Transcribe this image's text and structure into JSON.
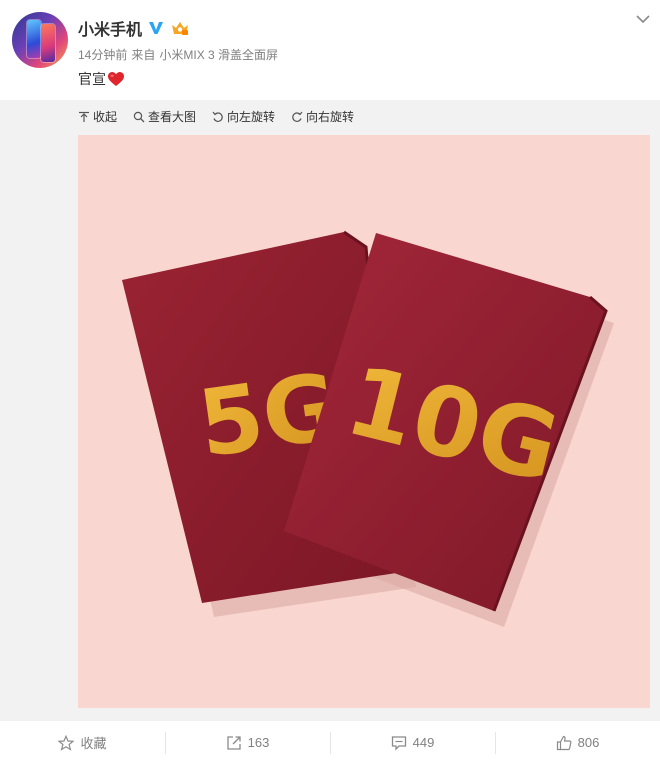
{
  "post": {
    "author": "小米手机",
    "time": "14分钟前",
    "from_prefix": "来自",
    "source": "小米MIX 3 滑盖全面屏",
    "text": "官宣"
  },
  "media_toolbar": {
    "collapse": "收起",
    "view_large": "查看大图",
    "rotate_left": "向左旋转",
    "rotate_right": "向右旋转"
  },
  "image": {
    "left_book_text": "5G",
    "right_book_text": "10G",
    "background_color": "#fad6d0",
    "book_color": "#8e1d2c",
    "gold_color": "#e1a52a"
  },
  "actions": {
    "favorite": "收藏",
    "repost_count": "163",
    "comment_count": "449",
    "like_count": "806"
  },
  "colors": {
    "verified_blue": "#2aa4f4",
    "heart_red": "#e0262d"
  }
}
